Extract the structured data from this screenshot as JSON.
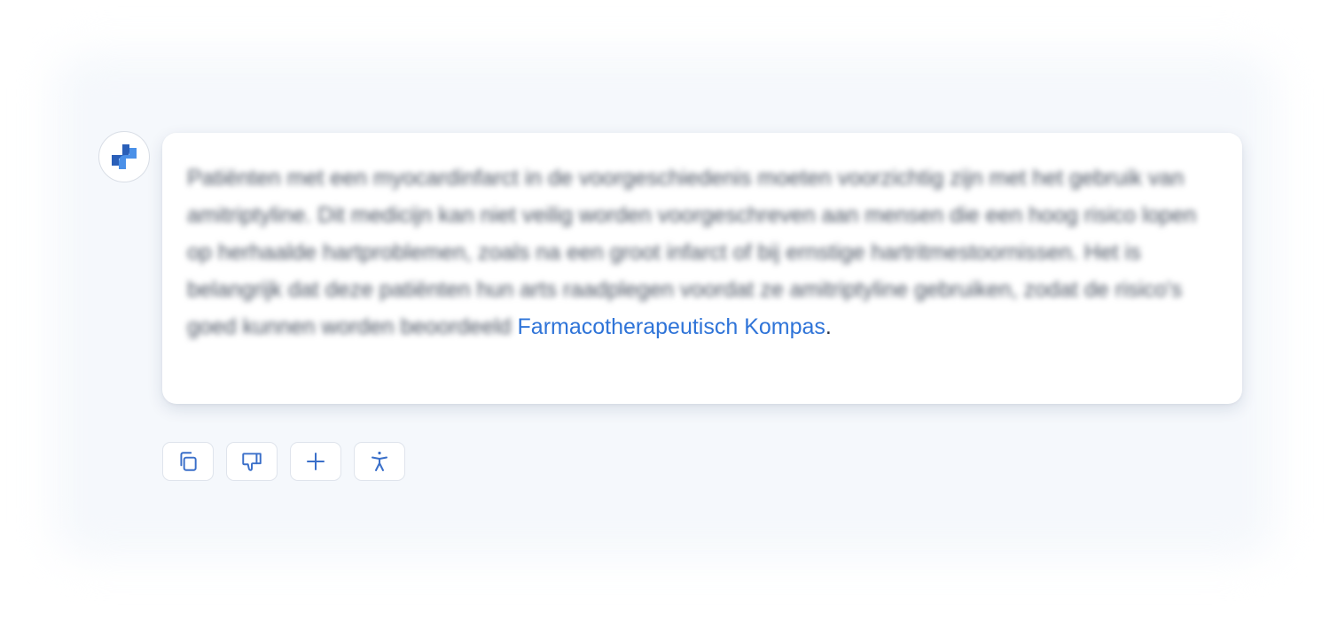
{
  "message": {
    "body_text": "Patiënten met een myocardinfarct in de voorgeschiedenis moeten voorzichtig zijn met het gebruik van amitriptyline. Dit medicijn kan niet veilig worden voorgeschreven aan mensen die een hoog risico lopen op herhaalde hartproblemen, zoals na een groot infarct of bij ernstige hartritmestoornissen. Het is belangrijk dat deze patiënten hun arts raadplegen voordat ze amitriptyline gebruiken, zodat de risico's goed kunnen worden beoordeeld",
    "source_link": "Farmacotherapeutisch Kompas",
    "trailing_punctuation": "."
  },
  "avatar": {
    "icon": "medical-cross-logo-icon",
    "colors": [
      "#2a5fb8",
      "#4a90e8"
    ]
  },
  "actions": [
    {
      "name": "copy-button",
      "icon": "copy-icon"
    },
    {
      "name": "thumbs-down-button",
      "icon": "thumbs-down-icon"
    },
    {
      "name": "add-button",
      "icon": "plus-icon"
    },
    {
      "name": "accessibility-button",
      "icon": "accessibility-icon"
    }
  ],
  "colors": {
    "accent": "#2f74d8",
    "icon": "#3a6fc9",
    "text": "#404a5a",
    "border": "#dfe4ec"
  }
}
